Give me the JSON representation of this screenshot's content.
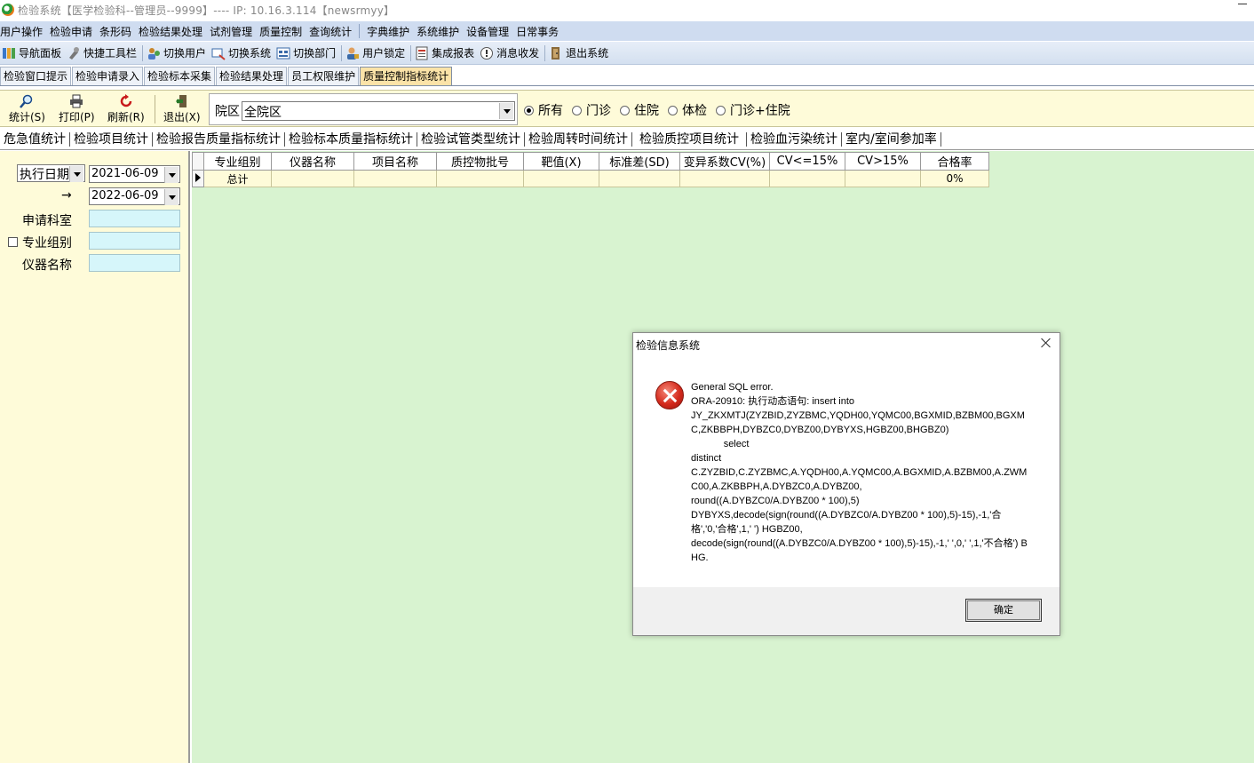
{
  "window": {
    "title": "检验系统【医学检验科--管理员--9999】---- IP:  10.16.3.114【newsrmyy】"
  },
  "menu": [
    "用户操作",
    "检验申请",
    "条形码",
    "检验结果处理",
    "试剂管理",
    "质量控制",
    "查询统计",
    "字典维护",
    "系统维护",
    "设备管理",
    "日常事务"
  ],
  "toolbar": [
    {
      "label": "导航面板",
      "icon": "navigation-icon"
    },
    {
      "label": "快捷工具栏",
      "icon": "quick-toolbar-icon"
    },
    {
      "label": "切换用户",
      "icon": "switch-user-icon"
    },
    {
      "label": "切换系统",
      "icon": "switch-system-icon"
    },
    {
      "label": "切换部门",
      "icon": "switch-department-icon"
    },
    {
      "label": "用户锁定",
      "icon": "user-lock-icon"
    },
    {
      "label": "集成报表",
      "icon": "report-icon"
    },
    {
      "label": "消息收发",
      "icon": "message-icon"
    },
    {
      "label": "退出系统",
      "icon": "exit-icon"
    }
  ],
  "doc_tabs": [
    "检验窗口提示",
    "检验申请录入",
    "检验标本采集",
    "检验结果处理",
    "员工权限维护",
    "质量控制指标统计"
  ],
  "active_doc_tab": "质量控制指标统计",
  "filterbar": {
    "buttons": [
      {
        "label": "统计(S)",
        "icon": "search-icon"
      },
      {
        "label": "打印(P)",
        "icon": "printer-icon"
      },
      {
        "label": "刷新(R)",
        "icon": "refresh-icon"
      },
      {
        "label": "退出(X)",
        "icon": "exit-door-icon"
      }
    ],
    "yuanqu_label": "院区",
    "yuanqu_value": "全院区",
    "radios": [
      {
        "label": "所有",
        "checked": true
      },
      {
        "label": "门诊",
        "checked": false
      },
      {
        "label": "住院",
        "checked": false
      },
      {
        "label": "体检",
        "checked": false
      },
      {
        "label": "门诊+住院",
        "checked": false
      }
    ]
  },
  "sub_tabs": [
    "危急值统计",
    "检验项目统计",
    "检验报告质量指标统计",
    "检验标本质量指标统计",
    "检验试管类型统计",
    "检验周转时间统计",
    "检验质控项目统计",
    "检验血污染统计",
    "室内/室间参加率"
  ],
  "active_sub_tab": "检验质控项目统计",
  "left_panel": {
    "date_type": "执行日期",
    "date_from": "2021-06-09",
    "arrow": "→",
    "date_to": "2022-06-09",
    "dept_label": "申请科室",
    "group_label": "专业组别",
    "group_checked": false,
    "instrument_label": "仪器名称"
  },
  "grid": {
    "columns": [
      "专业组别",
      "仪器名称",
      "项目名称",
      "质控物批号",
      "靶值(X)",
      "标准差(SD)",
      "变异系数CV(%)",
      "CV<=15%",
      "CV>15%",
      "合格率"
    ],
    "rows": [
      [
        "总计",
        "",
        "",
        "",
        "",
        "",
        "",
        "",
        "",
        "0%"
      ]
    ]
  },
  "dialog": {
    "title": "检验信息系统",
    "message": "General SQL error.\nORA-20910: 执行动态语句: insert into\nJY_ZKXMTJ(ZYZBID,ZYZBMC,YQDH00,YQMC00,BGXMID,BZBM00,BGXMC,ZKBBPH,DYBZC0,DYBZ00,DYBYXS,HGBZ00,BHGBZ0)\n            select\ndistinct\nC.ZYZBID,C.ZYZBMC,A.YQDH00,A.YQMC00,A.BGXMID,A.BZBM00,A.ZWMC00,A.ZKBBPH,A.DYBZC0,A.DYBZ00,\nround((A.DYBZC0/A.DYBZ00 * 100),5)\nDYBYXS,decode(sign(round((A.DYBZC0/A.DYBZ00 * 100),5)-15),-1,'合格','0,'合格',1,' ') HGBZ00,\ndecode(sign(round((A.DYBZC0/A.DYBZ00 * 100),5)-15),-1,' ',0,' ',1,'不合格') BHG.",
    "ok_label": "确定"
  }
}
